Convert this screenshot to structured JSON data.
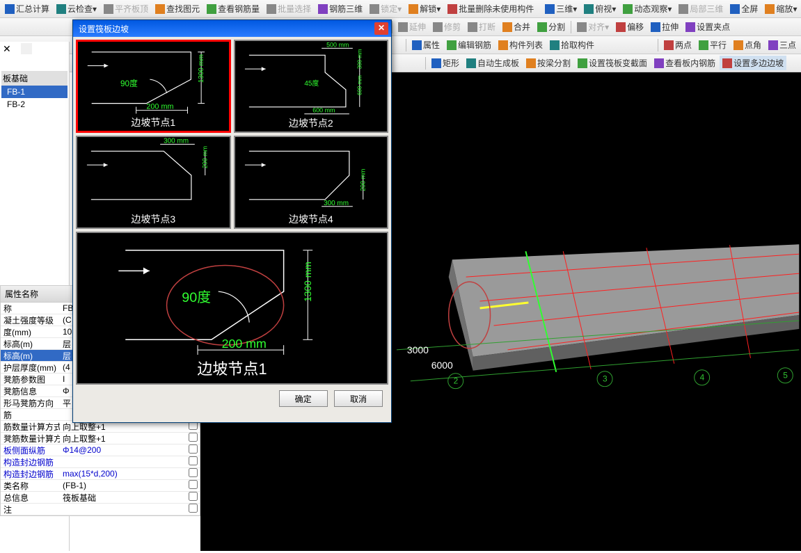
{
  "toolbar1": {
    "items": [
      "汇总计算",
      "云检查",
      "平齐板顶",
      "查找图元",
      "查看钢筋量",
      "批量选择",
      "钢筋三维",
      "锁定",
      "解锁",
      "批量删除未使用构件",
      "三维",
      "俯视",
      "动态观察",
      "局部三维",
      "全屏",
      "缩放"
    ]
  },
  "toolbar2": {
    "items": [
      "延伸",
      "修剪",
      "打断",
      "合并",
      "分割",
      "对齐",
      "偏移",
      "拉伸",
      "设置夹点"
    ]
  },
  "toolbar3": {
    "items": [
      "属性",
      "编辑钢筋",
      "构件列表",
      "拾取构件"
    ],
    "right": [
      "两点",
      "平行",
      "点角",
      "三点"
    ]
  },
  "toolbar4": {
    "items": [
      "矩形",
      "自动生成板",
      "按梁分割",
      "设置筏板变截面",
      "查看板内钢筋",
      "设置多边边坡"
    ]
  },
  "tree": {
    "section": "板基础",
    "items": [
      "FB-1",
      "FB-2"
    ],
    "selected": "FB-1"
  },
  "props": {
    "header_label": "属性名称",
    "header_extra": "",
    "rows": [
      {
        "label": "称",
        "value": "FB"
      },
      {
        "label": "凝土强度等级",
        "value": "(C"
      },
      {
        "label": "度(mm)",
        "value": "10"
      },
      {
        "label": "标高(m)",
        "value": "层"
      },
      {
        "label": "标高(m)",
        "value": "层",
        "selected": true
      },
      {
        "label": "护层厚度(mm)",
        "value": "(4"
      },
      {
        "label": "凳筋参数图",
        "value": "I"
      },
      {
        "label": "凳筋信息",
        "value": "Φ"
      },
      {
        "label": "形马凳筋方向",
        "value": "平"
      },
      {
        "label": "筋",
        "value": ""
      },
      {
        "label": "筋数量计算方式",
        "value": "向上取整+1"
      },
      {
        "label": "凳筋数量计算方",
        "value": "向上取整+1"
      },
      {
        "label": "板侧面纵筋",
        "value": "Φ14@200",
        "blue": true
      },
      {
        "label": "构造封边钢筋",
        "value": "",
        "blue": true
      },
      {
        "label": "构造封边钢筋",
        "value": "max(15*d,200)",
        "blue": true
      },
      {
        "label": "类名称",
        "value": "(FB-1)"
      },
      {
        "label": "总信息",
        "value": "筏板基础"
      },
      {
        "label": "注",
        "value": ""
      }
    ]
  },
  "dialog": {
    "title": "设置筏板边坡",
    "thumbs": [
      {
        "label": "边坡节点1",
        "angle": "90度",
        "dim_h": "200 mm",
        "dim_v": "1300 mm"
      },
      {
        "label": "边坡节点2",
        "angle": "45度",
        "dim_top": "500 mm",
        "dim_v1": "300 mm",
        "dim_v2": "600 mm",
        "dim_b": "600 mm"
      },
      {
        "label": "边坡节点3",
        "dim_top": "300 mm",
        "dim_v": "200 mm"
      },
      {
        "label": "边坡节点4",
        "dim_b": "300 mm",
        "dim_v": "200 mm"
      }
    ],
    "preview": {
      "label": "边坡节点1",
      "angle": "90度",
      "dim_h": "200 mm",
      "dim_v": "1300 mm"
    },
    "ok": "确定",
    "cancel": "取消"
  },
  "viewport": {
    "dims": [
      "3000",
      "6000"
    ],
    "axes": [
      "2",
      "3",
      "4",
      "5"
    ]
  }
}
